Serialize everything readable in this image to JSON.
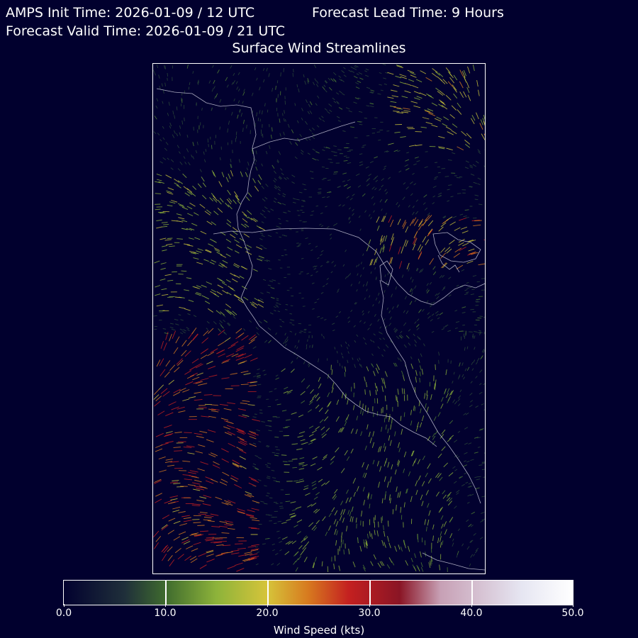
{
  "header": {
    "init_time": "AMPS Init Time: 2026-01-09 / 12 UTC",
    "lead_time": "Forecast Lead Time: 9 Hours",
    "valid_time": "Forecast Valid Time: 2026-01-09 / 21 UTC"
  },
  "plot": {
    "title": "Surface Wind Streamlines"
  },
  "colorbar": {
    "title": "Wind Speed (kts)",
    "tick_labels": [
      "0.0",
      "10.0",
      "20.0",
      "30.0",
      "40.0",
      "50.0"
    ],
    "range": [
      0,
      50
    ],
    "stops": [
      {
        "value": 0,
        "color": "#02012f"
      },
      {
        "value": 6,
        "color": "#1f2f3a"
      },
      {
        "value": 10,
        "color": "#3f6b2e"
      },
      {
        "value": 15,
        "color": "#8db33a"
      },
      {
        "value": 20,
        "color": "#d6c43a"
      },
      {
        "value": 24,
        "color": "#d77a1f"
      },
      {
        "value": 28,
        "color": "#c42020"
      },
      {
        "value": 33,
        "color": "#8a1525"
      },
      {
        "value": 37,
        "color": "#c7a0b5"
      },
      {
        "value": 45,
        "color": "#e6e6f2"
      },
      {
        "value": 50,
        "color": "#ffffff"
      }
    ]
  },
  "colors": {
    "background": "#01002e",
    "coastline": "#c8c8d8",
    "frame": "#ffffff"
  }
}
